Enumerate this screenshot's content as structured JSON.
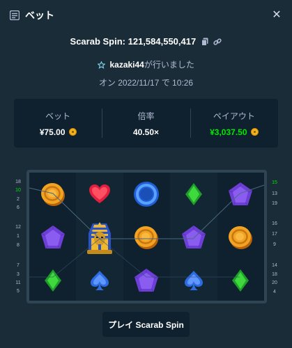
{
  "header": {
    "title": "ベット",
    "icon": "bets-icon",
    "close_icon": "close-icon"
  },
  "bet": {
    "game_label": "Scarab Spin",
    "bet_id": "121,584,550,417",
    "text": "Scarab Spin: 121,584,550,417"
  },
  "user": {
    "username": "kazaki44",
    "suffix": "が行いました",
    "icon": "star-icon"
  },
  "date": {
    "text": "オン 2022/11/17 で 10:26"
  },
  "stats": {
    "bet_label": "ベット",
    "bet_value": "¥75.00",
    "multiplier_label": "倍率",
    "multiplier_value": "40.50×",
    "payout_label": "ペイアウト",
    "payout_value": "¥3,037.50",
    "payout_color": "#00e701"
  },
  "paylines": {
    "left": [
      "18",
      "10",
      "2",
      "6",
      "12",
      "1",
      "8",
      "7",
      "3",
      "11",
      "5"
    ],
    "right": [
      "15",
      "13",
      "19",
      "16",
      "17",
      "9",
      "14",
      "18",
      "20",
      "4"
    ],
    "highlighted": [
      "10",
      "15"
    ]
  },
  "reels": [
    [
      "coin",
      "pentagon",
      "diamond"
    ],
    [
      "heart",
      "pharaoh",
      "spade"
    ],
    [
      "ring",
      "coin",
      "pentagon"
    ],
    [
      "diamond",
      "pentagon",
      "spade"
    ],
    [
      "pentagon",
      "coin",
      "diamond"
    ]
  ],
  "play_button": {
    "label": "プレイ Scarab Spin"
  }
}
